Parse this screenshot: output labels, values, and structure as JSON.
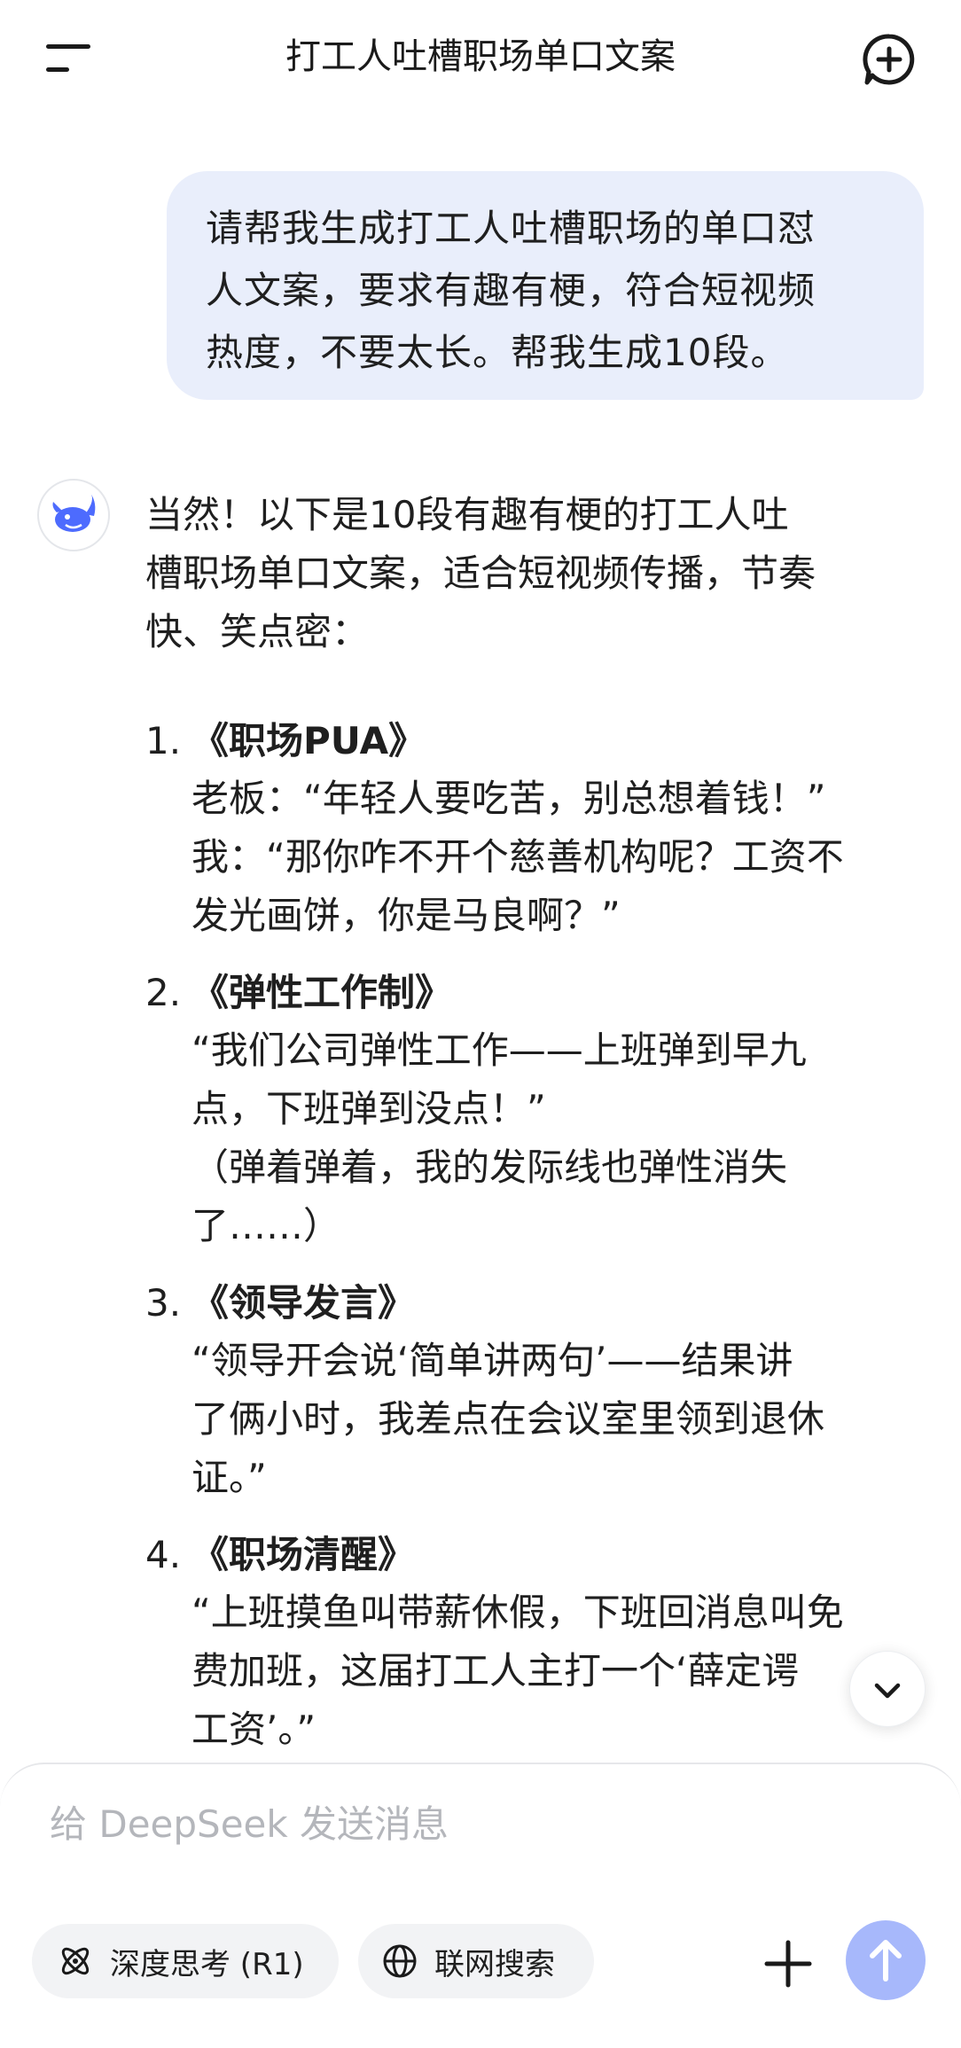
{
  "header": {
    "title": "打工人吐槽职场单口文案",
    "menu_icon": "menu-icon",
    "new_chat_icon": "new-chat-icon"
  },
  "user_message": {
    "lines": [
      "请帮我生成打工人吐槽职场的单口怼",
      "人文案，要求有趣有梗，符合短视频",
      "热度，不要太长。帮我生成10段。"
    ]
  },
  "assistant": {
    "avatar_icon": "deepseek-whale-icon",
    "intro_lines": [
      "当然！以下是10段有趣有梗的打工人吐",
      "槽职场单口文案，适合短视频传播，节奏",
      "快、笑点密："
    ],
    "items": [
      {
        "num": "1.",
        "title": "《职场PUA》",
        "lines": [
          "老板：“年轻人要吃苦，别总想着钱！”",
          "我：“那你咋不开个慈善机构呢？工资不",
          "发光画饼，你是马良啊？”"
        ]
      },
      {
        "num": "2.",
        "title": "《弹性工作制》",
        "lines": [
          "“我们公司弹性工作——上班弹到早九",
          "点，下班弹到没点！”",
          "（弹着弹着，我的发际线也弹性消失",
          "了……）"
        ]
      },
      {
        "num": "3.",
        "title": "《领导发言》",
        "lines": [
          "“领导开会说‘简单讲两句’——结果讲",
          "了俩小时，我差点在会议室里领到退休",
          "证。”"
        ]
      },
      {
        "num": "4.",
        "title": "《职场清醒》",
        "lines": [
          "“上班摸鱼叫带薪休假，下班回消息叫免",
          "费加班，这届打工人主打一个‘薛定谔",
          "工资’。”"
        ]
      }
    ]
  },
  "scroll_down_icon": "chevron-down-icon",
  "composer": {
    "placeholder": "给 DeepSeek 发送消息",
    "deep_think_label": "深度思考 (R1)",
    "web_search_label": "联网搜索",
    "accent_color": "#a7b8fb"
  }
}
